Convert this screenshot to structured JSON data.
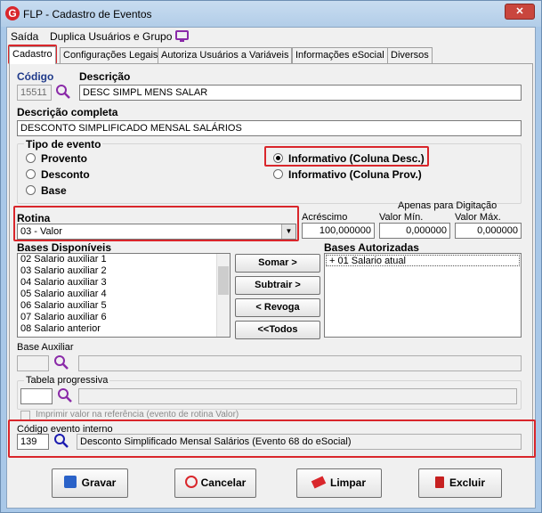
{
  "window": {
    "title": "FLP - Cadastro de Eventos"
  },
  "menu": [
    "Saída",
    "Duplica Usuários e Grupo"
  ],
  "tabs": [
    "Cadastro",
    "Configurações Legais",
    "Autoriza Usuários a Variáveis",
    "Informações eSocial",
    "Diversos"
  ],
  "form": {
    "codigo_label": "Código",
    "codigo_value": "15511",
    "descricao_label": "Descrição",
    "descricao_value": "DESC SIMPL MENS SALAR",
    "descricao_completa_label": "Descrição completa",
    "descricao_completa_value": "DESCONTO SIMPLIFICADO MENSAL SALÁRIOS",
    "tipo_label": "Tipo de evento",
    "tipo_options": [
      "Provento",
      "Desconto",
      "Base",
      "Informativo (Coluna Desc.)",
      "Informativo (Coluna Prov.)"
    ],
    "tipo_selected": "Informativo (Coluna Desc.)",
    "rotina_label": "Rotina",
    "rotina_value": "03 - Valor",
    "apenas_label": "Apenas para Digitação",
    "acrescimo_label": "Acréscimo",
    "acrescimo_value": "100,000000",
    "valor_min_label": "Valor Mín.",
    "valor_min_value": "0,000000",
    "valor_max_label": "Valor Máx.",
    "valor_max_value": "0,000000",
    "bases_disp_label": "Bases Disponíveis",
    "bases_disp": [
      "02 Salario auxiliar 1",
      "03 Salario auxiliar 2",
      "04 Salario auxiliar 3",
      "05 Salario auxiliar 4",
      "06 Salario auxiliar 5",
      "07 Salario auxiliar 6",
      "08 Salario anterior"
    ],
    "bases_aut_label": "Bases Autorizadas",
    "bases_aut": [
      "+ 01 Salario atual"
    ],
    "somar": "Somar >",
    "subtrair": "Subtrair >",
    "revoga": "< Revoga",
    "todos": "<<Todos",
    "base_aux_label": "Base Auxiliar",
    "tabela_label": "Tabela progressiva",
    "imprimir_label": "Imprimir valor na referência (evento de rotina Valor)",
    "codigo_int_label": "Código evento interno",
    "codigo_int_value": "139",
    "codigo_int_desc": "Desconto Simplificado Mensal Salários (Evento 68 do eSocial)"
  },
  "buttons": {
    "gravar": "Gravar",
    "cancelar": "Cancelar",
    "limpar": "Limpar",
    "excluir": "Excluir"
  }
}
